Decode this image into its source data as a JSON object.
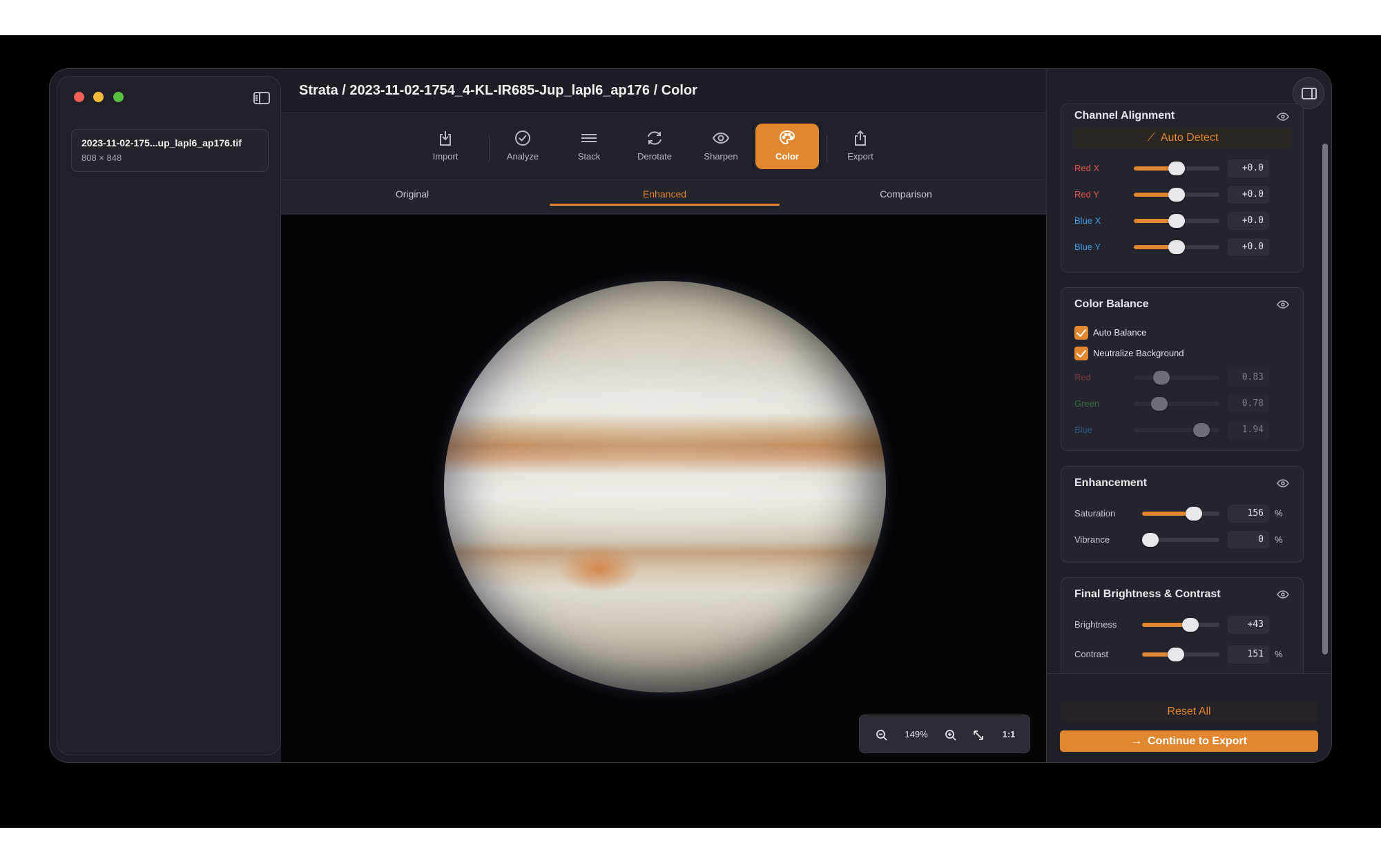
{
  "window": {
    "breadcrumb": "Strata / 2023-11-02-1754_4-KL-IR685-Jup_lapl6_ap176 / Color"
  },
  "sidebar": {
    "files": [
      {
        "name": "2023-11-02-175...up_lapl6_ap176.tif",
        "dims": "808 × 848"
      }
    ]
  },
  "toolbar": {
    "items": [
      {
        "label": "Import",
        "icon": "import-icon"
      },
      {
        "label": "Analyze",
        "icon": "check-circle-icon"
      },
      {
        "label": "Stack",
        "icon": "stack-icon"
      },
      {
        "label": "Derotate",
        "icon": "rotate-icon"
      },
      {
        "label": "Sharpen",
        "icon": "eye-icon"
      },
      {
        "label": "Color",
        "icon": "palette-icon",
        "active": true
      },
      {
        "label": "Export",
        "icon": "share-icon"
      }
    ]
  },
  "view_tabs": [
    {
      "label": "Original"
    },
    {
      "label": "Enhanced",
      "active": true
    },
    {
      "label": "Comparison"
    }
  ],
  "zoom": {
    "level": "149%",
    "one_to_one": "1:1"
  },
  "panel": {
    "channel_alignment": {
      "title": "Channel Alignment",
      "auto_detect": "Auto Detect",
      "rows": [
        {
          "label": "Red X",
          "value": "+0.0",
          "level": 0.5,
          "color": "#e8574f"
        },
        {
          "label": "Red Y",
          "value": "+0.0",
          "level": 0.5,
          "color": "#e8574f"
        },
        {
          "label": "Blue X",
          "value": "+0.0",
          "level": 0.5,
          "color": "#3d9be9"
        },
        {
          "label": "Blue Y",
          "value": "+0.0",
          "level": 0.5,
          "color": "#3d9be9"
        }
      ]
    },
    "color_balance": {
      "title": "Color Balance",
      "auto_balance": "Auto Balance",
      "neutralize_background": "Neutralize Background",
      "rows": [
        {
          "label": "Red",
          "value": "0.83",
          "level": 0.28,
          "color": "#e8574f"
        },
        {
          "label": "Green",
          "value": "0.78",
          "level": 0.25,
          "color": "#4ebd5b"
        },
        {
          "label": "Blue",
          "value": "1.94",
          "level": 0.86,
          "color": "#3d9be9"
        }
      ]
    },
    "enhancement": {
      "title": "Enhancement",
      "rows": [
        {
          "label": "Saturation",
          "value": "156",
          "unit": "%",
          "level": 0.72
        },
        {
          "label": "Vibrance",
          "value": "0",
          "unit": "%",
          "level": 0.0
        }
      ]
    },
    "final": {
      "title": "Final Brightness & Contrast",
      "rows": [
        {
          "label": "Brightness",
          "value": "+43",
          "unit": "",
          "level": 0.66
        },
        {
          "label": "Contrast",
          "value": "151",
          "unit": "%",
          "level": 0.42
        }
      ]
    },
    "reset_label": "Reset All",
    "continue_label": "Continue to Export"
  },
  "colors": {
    "accent": "#e0872f"
  }
}
